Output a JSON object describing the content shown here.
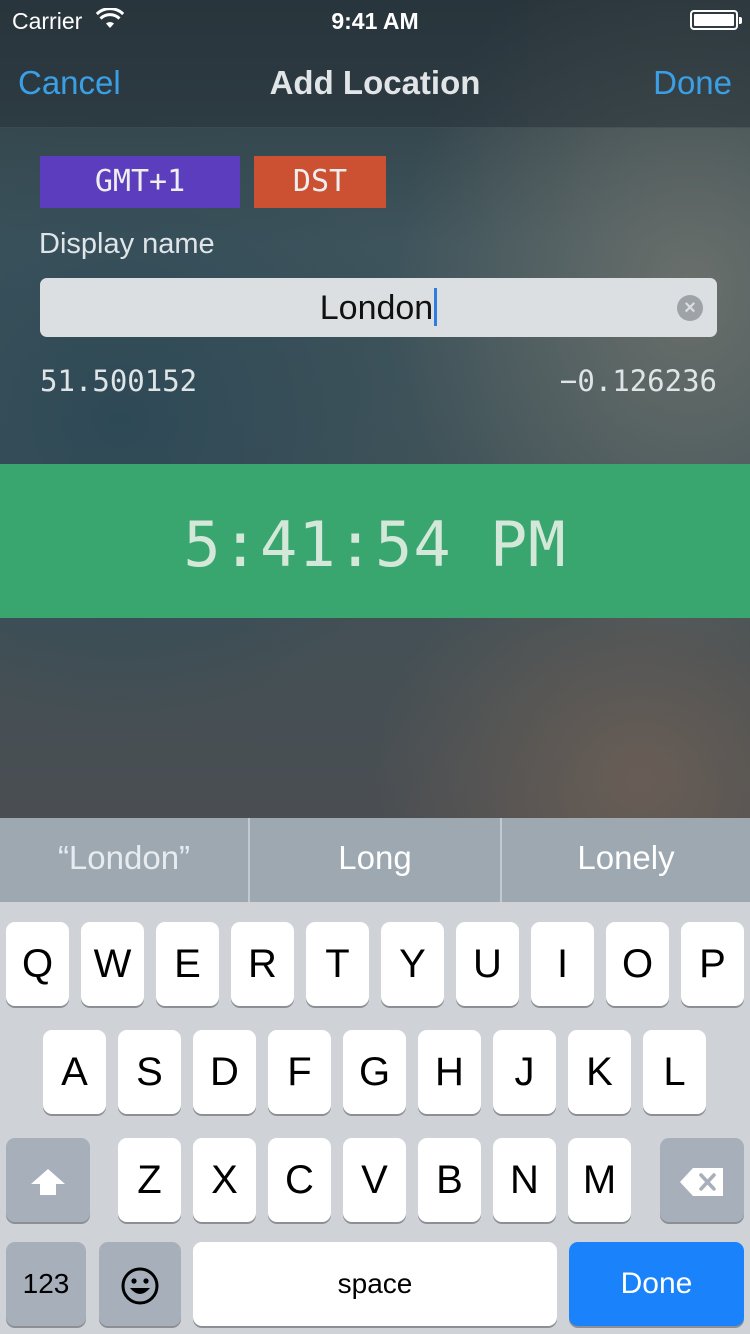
{
  "status_bar": {
    "carrier": "Carrier",
    "time": "9:41 AM"
  },
  "nav": {
    "cancel": "Cancel",
    "title": "Add Location",
    "done": "Done"
  },
  "badges": {
    "timezone": "GMT+1",
    "dst": "DST"
  },
  "form": {
    "display_name_label": "Display name",
    "display_name_value": "London",
    "latitude": "51.500152",
    "longitude": "−0.126236"
  },
  "clock": {
    "time": "5:41:54 PM"
  },
  "suggestions": [
    "“London”",
    "Long",
    "Lonely"
  ],
  "keyboard": {
    "row1": [
      "Q",
      "W",
      "E",
      "R",
      "T",
      "Y",
      "U",
      "I",
      "O",
      "P"
    ],
    "row2": [
      "A",
      "S",
      "D",
      "F",
      "G",
      "H",
      "J",
      "K",
      "L"
    ],
    "row3": [
      "Z",
      "X",
      "C",
      "V",
      "B",
      "N",
      "M"
    ],
    "numbers_key": "123",
    "space_key": "space",
    "return_key": "Done"
  },
  "colors": {
    "accent": "#3b9fe6",
    "gmt_badge": "#5b3dbd",
    "dst_badge": "#cc5032",
    "clock_band": "#3aa66f",
    "keyboard_done": "#1a82fb"
  }
}
